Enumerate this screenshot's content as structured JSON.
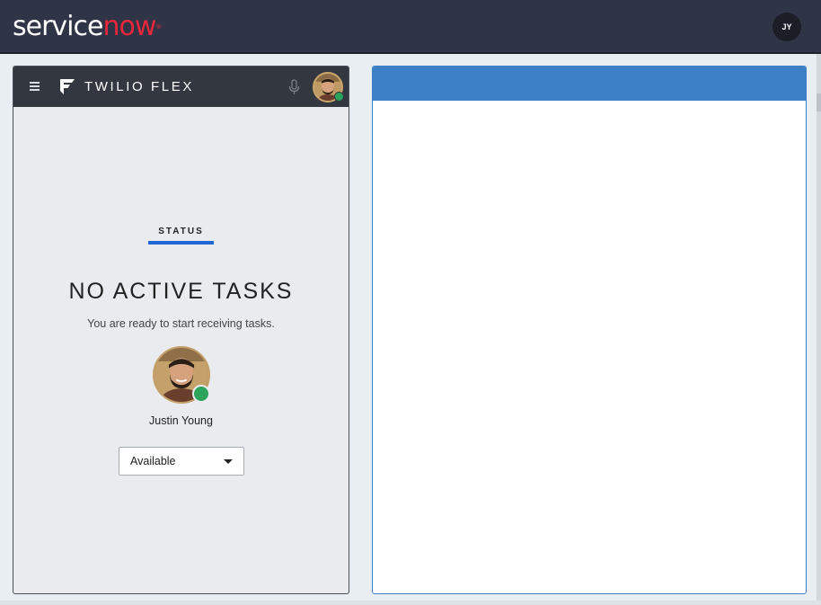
{
  "servicenow": {
    "logo_main": "service",
    "logo_accent": "now",
    "logo_mark": "®",
    "user_initials": "JY"
  },
  "flex": {
    "title": "TWILIO FLEX",
    "status_tab": "STATUS",
    "heading": "NO ACTIVE TASKS",
    "message": "You are ready to start receiving tasks.",
    "agent_name": "Justin Young",
    "activity": {
      "selected": "Available"
    },
    "status_color": "#2ba35a"
  },
  "icons": {
    "menu": "hamburger-icon",
    "brand": "twilio-logo-icon",
    "mic": "microphone-icon",
    "dropdown": "caret-down-icon"
  },
  "colors": {
    "sn_header": "#2f3446",
    "sn_accent": "#e8273a",
    "flex_bar": "#33373f",
    "tab_underline": "#1f67d1",
    "crm_header": "#3d7fc6"
  }
}
